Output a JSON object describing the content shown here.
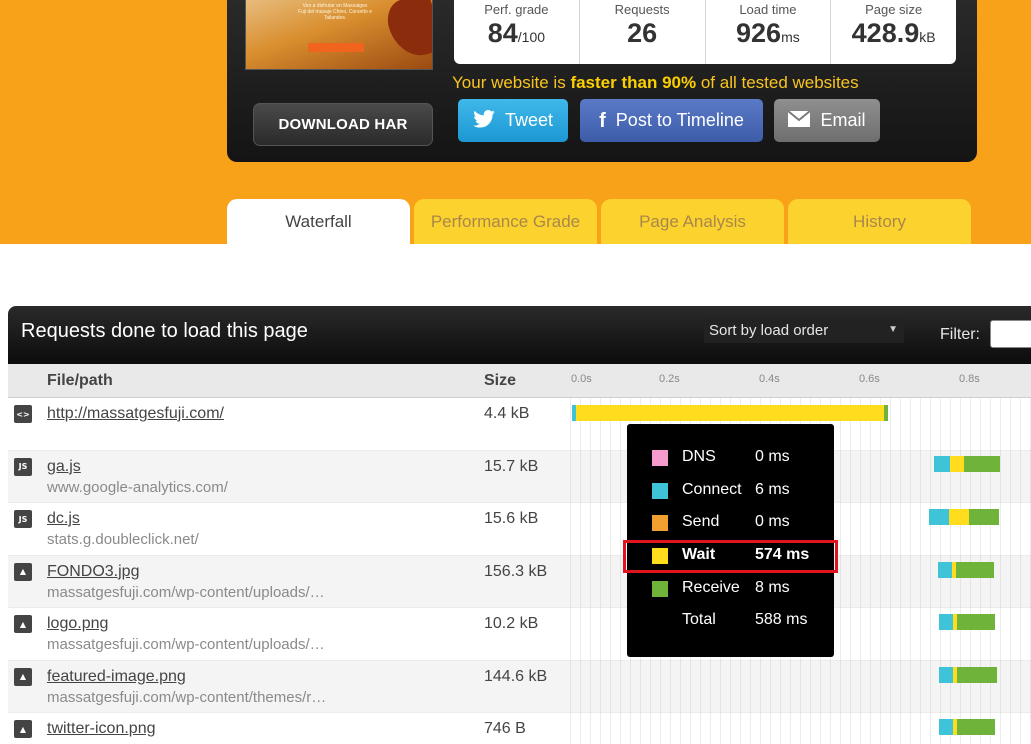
{
  "summary": {
    "thumbnail_text": "Ven a disfrutar en Massatges Fuji del masaje Chino, Corsetto e Tailandes.",
    "stats": [
      {
        "label": "Perf. grade",
        "value": "84",
        "unit": "/100"
      },
      {
        "label": "Requests",
        "value": "26",
        "unit": ""
      },
      {
        "label": "Load time",
        "value": "926",
        "unit": "ms"
      },
      {
        "label": "Page size",
        "value": "428.9",
        "unit": "kB"
      }
    ],
    "download_label": "DOWNLOAD HAR",
    "faster_prefix": "Your website is ",
    "faster_bold": "faster than 90%",
    "faster_suffix": " of all tested websites",
    "tweet_label": "Tweet",
    "facebook_label": "Post to Timeline",
    "email_label": "Email"
  },
  "tabs": [
    {
      "label": "Waterfall",
      "active": true
    },
    {
      "label": "Performance Grade",
      "active": false
    },
    {
      "label": "Page Analysis",
      "active": false
    },
    {
      "label": "History",
      "active": false
    }
  ],
  "requests": {
    "title": "Requests done to load this page",
    "sort_value": "Sort by load order",
    "filter_label": "Filter:",
    "col_file": "File/path",
    "col_size": "Size",
    "ticks": [
      "0.0s",
      "0.2s",
      "0.4s",
      "0.6s",
      "0.8s"
    ],
    "rows": [
      {
        "icon": "<>",
        "name": "http://massatgesfuji.com/",
        "host": "",
        "size": "4.4 kB"
      },
      {
        "icon": "JS",
        "name": "ga.js",
        "host": "www.google-analytics.com/",
        "size": "15.7 kB"
      },
      {
        "icon": "JS",
        "name": "dc.js",
        "host": "stats.g.doubleclick.net/",
        "size": "15.6 kB"
      },
      {
        "icon": "img",
        "name": "FONDO3.jpg",
        "host": "massatgesfuji.com/wp-content/uploads/…",
        "size": "156.3 kB"
      },
      {
        "icon": "img",
        "name": "logo.png",
        "host": "massatgesfuji.com/wp-content/uploads/…",
        "size": "10.2 kB"
      },
      {
        "icon": "img",
        "name": "featured-image.png",
        "host": "massatgesfuji.com/wp-content/themes/r…",
        "size": "144.6 kB"
      },
      {
        "icon": "img",
        "name": "twitter-icon.png",
        "host": "",
        "size": "746 B"
      }
    ]
  },
  "tooltip": {
    "rows": [
      {
        "label": "DNS",
        "value": "0 ms",
        "color": "#f59ccd"
      },
      {
        "label": "Connect",
        "value": "6 ms",
        "color": "#3ec3d9"
      },
      {
        "label": "Send",
        "value": "0 ms",
        "color": "#f0a030"
      },
      {
        "label": "Wait",
        "value": "574 ms",
        "color": "#ffdd1e"
      },
      {
        "label": "Receive",
        "value": "8 ms",
        "color": "#6fb33a"
      },
      {
        "label": "Total",
        "value": "588 ms",
        "color": ""
      }
    ]
  },
  "colors": {
    "brand_orange": "#f8a21a",
    "tab_inactive": "#fcd22e",
    "highlight_border": "#e0141e"
  }
}
